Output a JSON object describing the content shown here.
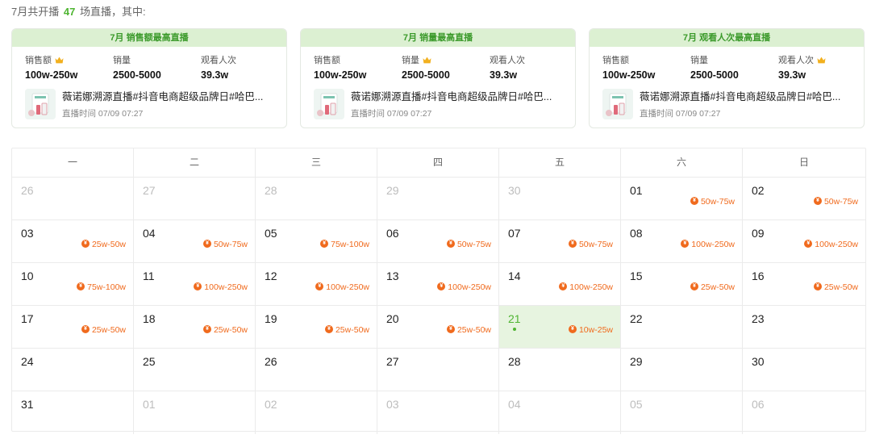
{
  "summary": {
    "prefix": "7月共开播",
    "count": "47",
    "suffix": "场直播，其中:"
  },
  "cards": [
    {
      "header": "7月 销售额最高直播",
      "metrics": [
        {
          "label": "销售额",
          "value": "100w-250w",
          "crown": true
        },
        {
          "label": "销量",
          "value": "2500-5000",
          "crown": false
        },
        {
          "label": "观看人次",
          "value": "39.3w",
          "crown": false
        }
      ],
      "title": "薇诺娜溯源直播#抖音电商超级品牌日#哈巴...",
      "time": "直播时间 07/09 07:27"
    },
    {
      "header": "7月 销量最高直播",
      "metrics": [
        {
          "label": "销售额",
          "value": "100w-250w",
          "crown": false
        },
        {
          "label": "销量",
          "value": "2500-5000",
          "crown": true
        },
        {
          "label": "观看人次",
          "value": "39.3w",
          "crown": false
        }
      ],
      "title": "薇诺娜溯源直播#抖音电商超级品牌日#哈巴...",
      "time": "直播时间 07/09 07:27"
    },
    {
      "header": "7月 观看人次最高直播",
      "metrics": [
        {
          "label": "销售额",
          "value": "100w-250w",
          "crown": false
        },
        {
          "label": "销量",
          "value": "2500-5000",
          "crown": false
        },
        {
          "label": "观看人次",
          "value": "39.3w",
          "crown": true
        }
      ],
      "title": "薇诺娜溯源直播#抖音电商超级品牌日#哈巴...",
      "time": "直播时间 07/09 07:27"
    }
  ],
  "calendar": {
    "weekdays": [
      "一",
      "二",
      "三",
      "四",
      "五",
      "六",
      "日"
    ],
    "days": [
      {
        "num": "26",
        "other": true,
        "sales": ""
      },
      {
        "num": "27",
        "other": true,
        "sales": ""
      },
      {
        "num": "28",
        "other": true,
        "sales": ""
      },
      {
        "num": "29",
        "other": true,
        "sales": ""
      },
      {
        "num": "30",
        "other": true,
        "sales": ""
      },
      {
        "num": "01",
        "other": false,
        "sales": "50w-75w"
      },
      {
        "num": "02",
        "other": false,
        "sales": "50w-75w"
      },
      {
        "num": "03",
        "other": false,
        "sales": "25w-50w"
      },
      {
        "num": "04",
        "other": false,
        "sales": "50w-75w"
      },
      {
        "num": "05",
        "other": false,
        "sales": "75w-100w"
      },
      {
        "num": "06",
        "other": false,
        "sales": "50w-75w"
      },
      {
        "num": "07",
        "other": false,
        "sales": "50w-75w"
      },
      {
        "num": "08",
        "other": false,
        "sales": "100w-250w"
      },
      {
        "num": "09",
        "other": false,
        "sales": "100w-250w"
      },
      {
        "num": "10",
        "other": false,
        "sales": "75w-100w"
      },
      {
        "num": "11",
        "other": false,
        "sales": "100w-250w"
      },
      {
        "num": "12",
        "other": false,
        "sales": "100w-250w"
      },
      {
        "num": "13",
        "other": false,
        "sales": "100w-250w"
      },
      {
        "num": "14",
        "other": false,
        "sales": "100w-250w"
      },
      {
        "num": "15",
        "other": false,
        "sales": "25w-50w"
      },
      {
        "num": "16",
        "other": false,
        "sales": "25w-50w"
      },
      {
        "num": "17",
        "other": false,
        "sales": "25w-50w"
      },
      {
        "num": "18",
        "other": false,
        "sales": "25w-50w"
      },
      {
        "num": "19",
        "other": false,
        "sales": "25w-50w"
      },
      {
        "num": "20",
        "other": false,
        "sales": "25w-50w"
      },
      {
        "num": "21",
        "other": false,
        "today": true,
        "sales": "10w-25w"
      },
      {
        "num": "22",
        "other": false,
        "sales": ""
      },
      {
        "num": "23",
        "other": false,
        "sales": ""
      },
      {
        "num": "24",
        "other": false,
        "sales": ""
      },
      {
        "num": "25",
        "other": false,
        "sales": ""
      },
      {
        "num": "26",
        "other": false,
        "sales": ""
      },
      {
        "num": "27",
        "other": false,
        "sales": ""
      },
      {
        "num": "28",
        "other": false,
        "sales": ""
      },
      {
        "num": "29",
        "other": false,
        "sales": ""
      },
      {
        "num": "30",
        "other": false,
        "sales": ""
      },
      {
        "num": "31",
        "other": false,
        "sales": ""
      },
      {
        "num": "01",
        "other": true,
        "sales": ""
      },
      {
        "num": "02",
        "other": true,
        "sales": ""
      },
      {
        "num": "03",
        "other": true,
        "sales": ""
      },
      {
        "num": "04",
        "other": true,
        "sales": ""
      },
      {
        "num": "05",
        "other": true,
        "sales": ""
      },
      {
        "num": "06",
        "other": true,
        "sales": ""
      }
    ]
  },
  "colors": {
    "accent": "#4fb532",
    "header_bg": "#dcf0d2",
    "sales": "#f06a1d",
    "today_bg": "#e7f4e0"
  },
  "icons": {
    "crown": "crown-icon",
    "coin": "coin-icon"
  }
}
